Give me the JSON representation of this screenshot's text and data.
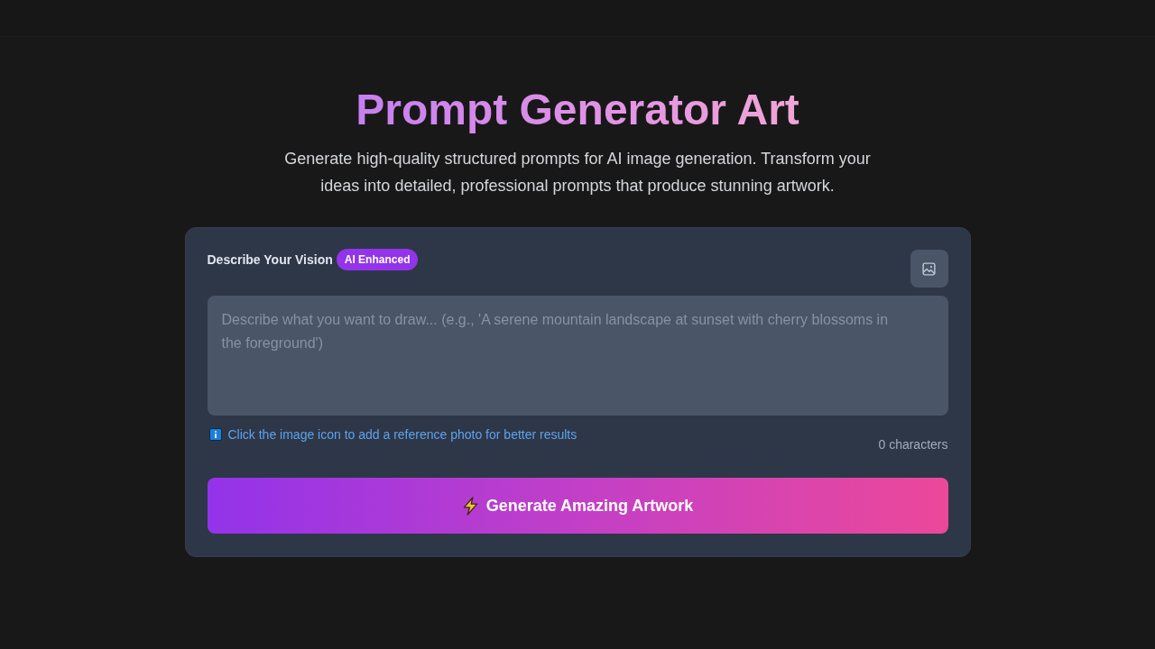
{
  "header": {
    "title": "Prompt Generator Art",
    "subtitle": "Generate high-quality structured prompts for AI image generation. Transform your ideas into detailed, professional prompts that produce stunning artwork."
  },
  "form": {
    "label": "Describe Your Vision",
    "badge": "AI Enhanced",
    "prompt": {
      "placeholder": "Describe what you want to draw... (e.g., 'A serene mountain landscape at sunset with cherry blossoms in the foreground')"
    },
    "hint": "Click the image icon to add a reference photo for better results",
    "char_count": "0 characters",
    "generate_button": {
      "label": "Generate Amazing Artwork"
    }
  }
}
